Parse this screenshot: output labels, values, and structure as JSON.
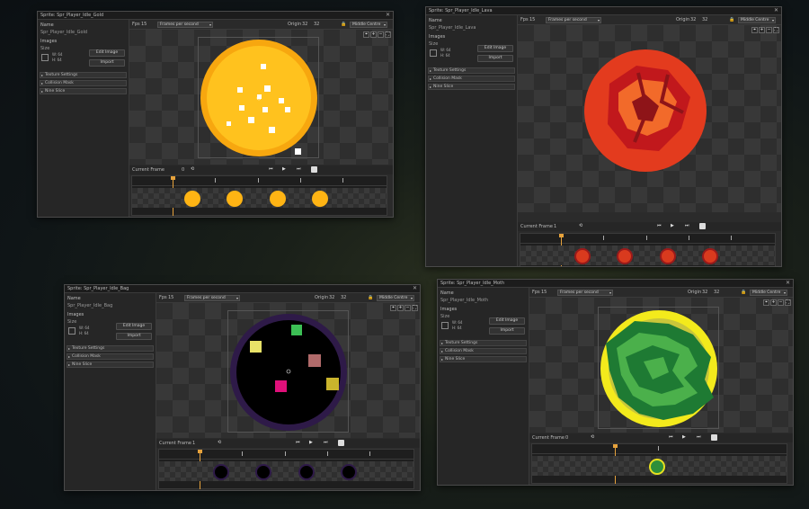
{
  "colors": {
    "accent": "#e6a23c",
    "panel": "#2a2a2a"
  },
  "windows": [
    {
      "title": "Sprite: Spr_Player_Idle_Gold",
      "name_label": "Name",
      "name_value": "Spr_Player_Idle_Gold",
      "images_label": "Images",
      "size_label": "Size",
      "w": "W: 64",
      "h": "H: 64",
      "edit_image": "Edit Image",
      "import": "Import",
      "texture_settings": "Texture Settings",
      "collision_mask": "Collision Mask",
      "nine_slice": "Nine Slice",
      "fps_label": "Fps",
      "fps_value": "15",
      "fps_mode": "Frames per second",
      "origin_label": "Origin",
      "origin_x": "32",
      "origin_y": "32",
      "origin_mode": "Middle Centre",
      "current_frame_label": "Current Frame",
      "current_frame_value": "0"
    },
    {
      "title": "Sprite: Spr_Player_Idle_Lava",
      "name_label": "Name",
      "name_value": "Spr_Player_Idle_Lava",
      "images_label": "Images",
      "size_label": "Size",
      "w": "W: 64",
      "h": "H: 64",
      "edit_image": "Edit Image",
      "import": "Import",
      "texture_settings": "Texture Settings",
      "collision_mask": "Collision Mask",
      "nine_slice": "Nine Slice",
      "fps_label": "Fps",
      "fps_value": "15",
      "fps_mode": "Frames per second",
      "origin_label": "Origin",
      "origin_x": "32",
      "origin_y": "32",
      "origin_mode": "Middle Centre",
      "current_frame_label": "Current Frame",
      "current_frame_value": "1"
    },
    {
      "title": "Sprite: Spr_Player_Idle_Bag",
      "name_label": "Name",
      "name_value": "Spr_Player_Idle_Bag",
      "images_label": "Images",
      "size_label": "Size",
      "w": "W: 64",
      "h": "H: 64",
      "edit_image": "Edit Image",
      "import": "Import",
      "texture_settings": "Texture Settings",
      "collision_mask": "Collision Mask",
      "nine_slice": "Nine Slice",
      "fps_label": "Fps",
      "fps_value": "15",
      "fps_mode": "Frames per second",
      "origin_label": "Origin",
      "origin_x": "32",
      "origin_y": "32",
      "origin_mode": "Middle Centre",
      "current_frame_label": "Current Frame",
      "current_frame_value": "1"
    },
    {
      "title": "Sprite: Spr_Player_Idle_Moth",
      "name_label": "Name",
      "name_value": "Spr_Player_Idle_Moth",
      "images_label": "Images",
      "size_label": "Size",
      "w": "W: 64",
      "h": "H: 64",
      "edit_image": "Edit Image",
      "import": "Import",
      "texture_settings": "Texture Settings",
      "collision_mask": "Collision Mask",
      "nine_slice": "Nine Slice",
      "fps_label": "Fps",
      "fps_value": "15",
      "fps_mode": "Frames per second",
      "origin_label": "Origin",
      "origin_x": "32",
      "origin_y": "32",
      "origin_mode": "Middle Centre",
      "current_frame_label": "Current Frame",
      "current_frame_value": "0"
    }
  ],
  "tools": [
    "zoom-select-icon",
    "zoom-in-icon",
    "zoom-out-icon",
    "fit-icon"
  ]
}
